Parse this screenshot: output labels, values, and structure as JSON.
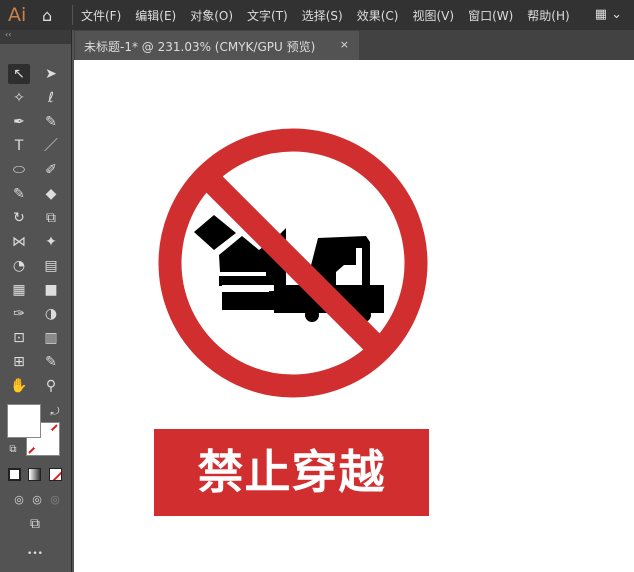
{
  "app": {
    "logo": "Ai"
  },
  "menu": [
    "文件(F)",
    "编辑(E)",
    "对象(O)",
    "文字(T)",
    "选择(S)",
    "效果(C)",
    "视图(V)",
    "窗口(W)",
    "帮助(H)"
  ],
  "tab": {
    "title": "未标题-1* @ 231.03% (CMYK/GPU 预览)",
    "close": "×"
  },
  "toolbar": {
    "collapse": "‹‹",
    "more": "•••"
  },
  "sign": {
    "text": "禁止穿越",
    "color": "#d12e2f"
  }
}
